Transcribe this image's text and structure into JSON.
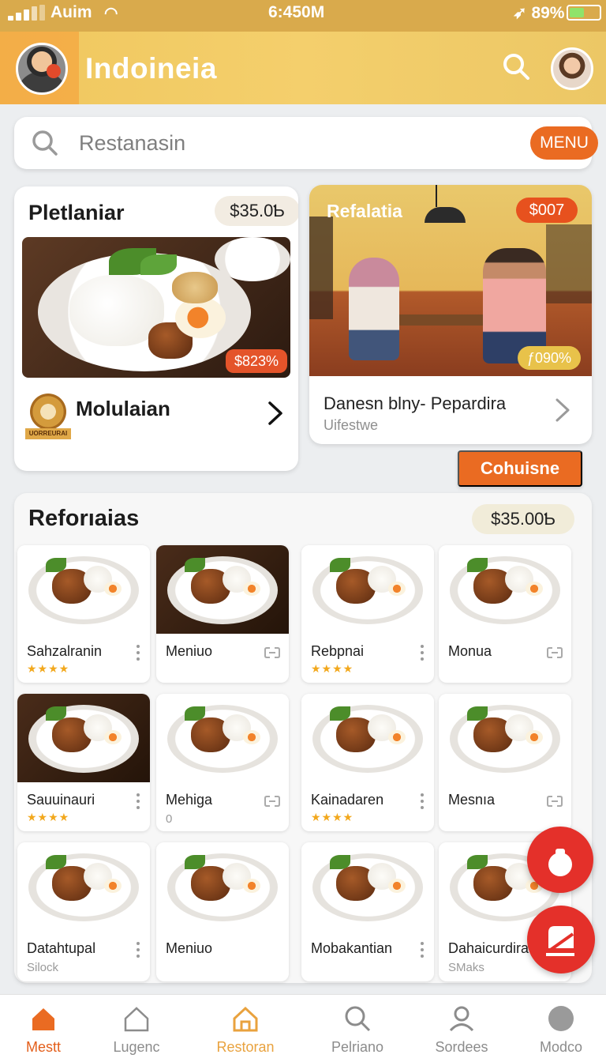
{
  "status_bar": {
    "carrier": "Auim",
    "time": "6:450M",
    "battery": "89%"
  },
  "header": {
    "title": "Indoineia"
  },
  "search": {
    "placeholder": "Restanasin",
    "menu_button": "MENU"
  },
  "featured": {
    "title": "Pletlaniar",
    "price": "$35.0Ƅ",
    "discount": "$823%",
    "brand_name": "Molulaian",
    "brand_logo_text": "UORREURAI"
  },
  "restaurant_card": {
    "label": "Refalatia",
    "price": "$007",
    "rating_badge": "ƒ090%",
    "title": "Danesn blny- Pepardira",
    "subtitle": "Uifestwe"
  },
  "cta_button": "Cohuisne",
  "section": {
    "title": "Reforıaias",
    "price": "$35.00Ƅ",
    "items": [
      {
        "name": "Sahzalranin",
        "stars": "★★★★",
        "action": "more",
        "dark": false
      },
      {
        "name": "Meniuo",
        "stars": "",
        "action": "link",
        "dark": true
      },
      {
        "name": "Rebpnai",
        "stars": "★★★★",
        "action": "more",
        "dark": false
      },
      {
        "name": "Monua",
        "stars": "",
        "action": "link",
        "dark": false
      },
      {
        "name": "Sauuinauri",
        "stars": "★★★★",
        "action": "more",
        "dark": true
      },
      {
        "name": "Mehiga",
        "sub": "0",
        "action": "link",
        "dark": false
      },
      {
        "name": "Kainadaren",
        "stars": "★★★★",
        "action": "more",
        "dark": false
      },
      {
        "name": "Mesnıa",
        "stars": "",
        "action": "link",
        "dark": false
      },
      {
        "name": "Datahtupal",
        "sub": "Silock",
        "action": "more",
        "dark": false
      },
      {
        "name": "Meniuo",
        "stars": "",
        "action": "none",
        "dark": false
      },
      {
        "name": "Mobakantian",
        "stars": "",
        "action": "more",
        "dark": false
      },
      {
        "name": "Dahaicurdira",
        "sub": "SMaks",
        "action": "none",
        "dark": false
      }
    ]
  },
  "bottom_nav": [
    {
      "label": "Mestt",
      "icon": "home-icon"
    },
    {
      "label": "Lugenc",
      "icon": "home-outline-icon"
    },
    {
      "label": "Restoran",
      "icon": "restaurant-home-icon"
    },
    {
      "label": "Pelriano",
      "icon": "search-icon"
    },
    {
      "label": "Sordees",
      "icon": "user-icon"
    },
    {
      "label": "Modco",
      "icon": "circle-icon"
    }
  ],
  "colors": {
    "accent": "#ea6b22",
    "header": "#f0c75e",
    "fab": "#e4302a",
    "star": "#f2a81d"
  }
}
